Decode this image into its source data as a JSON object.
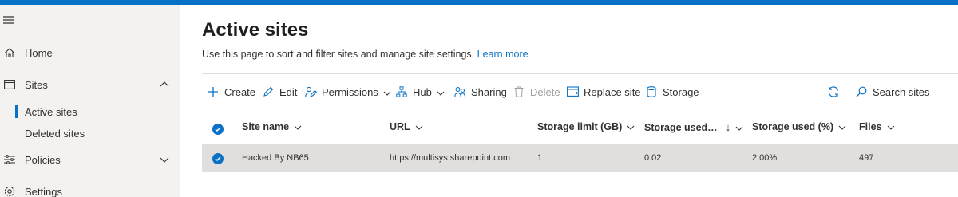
{
  "colors": {
    "accent": "#0a72c6",
    "nav_bg": "#f3f2f1",
    "row_selected_bg": "#e1dfdd",
    "disabled": "#a19f9d"
  },
  "nav": {
    "items": [
      {
        "label": "Home",
        "icon": "home-icon"
      },
      {
        "label": "Sites",
        "icon": "sites-icon",
        "expanded": true
      },
      {
        "label": "Policies",
        "icon": "policies-icon",
        "expanded": false
      },
      {
        "label": "Settings",
        "icon": "settings-icon"
      }
    ],
    "sites_children": [
      {
        "label": "Active sites",
        "selected": true
      },
      {
        "label": "Deleted sites",
        "selected": false
      }
    ]
  },
  "page": {
    "title": "Active sites",
    "description": "Use this page to sort and filter sites and manage site settings.",
    "learn_more": "Learn more"
  },
  "toolbar": {
    "create": "Create",
    "edit": "Edit",
    "permissions": "Permissions",
    "hub": "Hub",
    "sharing": "Sharing",
    "delete": "Delete",
    "replace_site": "Replace site",
    "storage": "Storage",
    "search": "Search sites"
  },
  "table": {
    "columns": {
      "site_name": "Site name",
      "url": "URL",
      "storage_limit": "Storage limit (GB)",
      "storage_used": "Storage used…",
      "storage_used_arrow": "↓",
      "storage_used_pct": "Storage used (%)",
      "files": "Files"
    },
    "rows": [
      {
        "site_name": "Hacked By NB65",
        "url": "https://multisys.sharepoint.com",
        "storage_limit": "1",
        "storage_used": "0.02",
        "storage_used_pct": "2.00%",
        "files": "497",
        "selected": true
      }
    ]
  }
}
